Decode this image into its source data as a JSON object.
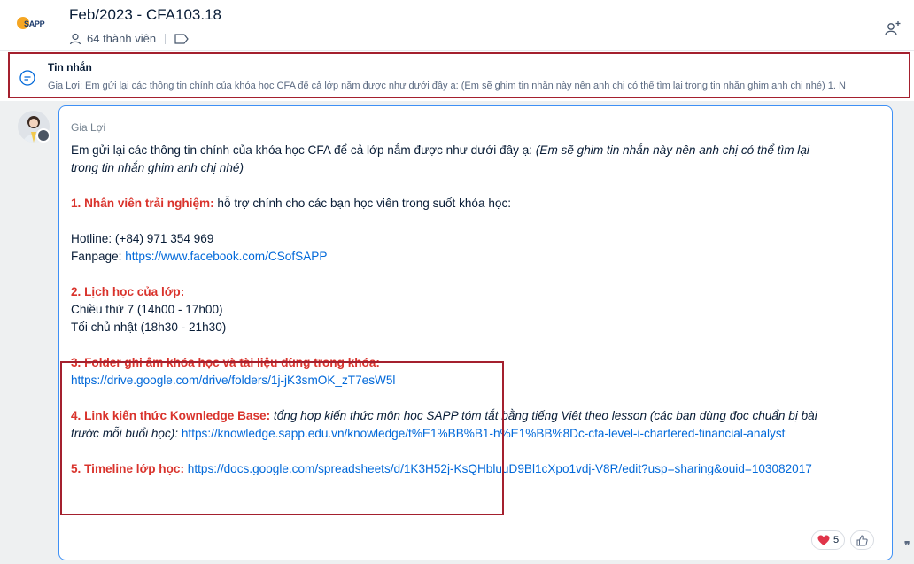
{
  "header": {
    "logo_text": "SAPP",
    "title": "Feb/2023 - CFA103.18",
    "members": "64 thành viên"
  },
  "pinned": {
    "title": "Tin nhắn",
    "preview": "Gia Lợi: Em gửi lại các thông tin chính của khóa học CFA để cả lớp nắm được như dưới đây ạ: (Em sẽ ghim tin nhắn này nên anh chị có thể tìm lại trong tin nhắn ghim anh chị nhé) 1. N"
  },
  "message": {
    "sender": "Gia Lợi",
    "intro": "Em gửi lại các thông tin chính của khóa học CFA để cả lớp nắm được như dưới đây ạ: ",
    "intro_note_1": "(Em sẽ ghim tin nhắn này nên anh chị có thể tìm lại",
    "intro_note_2": "trong tin nhắn ghim anh chị nhé)",
    "s1_head": "1. Nhân viên trải nghiệm:",
    "s1_text": " hỗ trợ chính cho các bạn học viên trong suốt khóa học:",
    "hotline": "Hotline: (+84) 971 354 969",
    "fanpage_label": "Fanpage: ",
    "fanpage_link": "https://www.facebook.com/CSofSAPP",
    "s2_head": "2. Lịch học của lớp:",
    "s2_line1": "Chiều thứ 7 (14h00 - 17h00)",
    "s2_line2": "Tối chủ nhật (18h30 - 21h30)",
    "s3_head": "3. Folder ghi âm khóa học và tài liệu dùng trong khóa:",
    "s3_link": "https://drive.google.com/drive/folders/1j-jK3smOK_zT7esW5l",
    "s4_head": "4. Link kiến thức Kownledge Base:",
    "s4_note_1": " tổng hợp kiến thức môn học SAPP tóm tắt bằng tiếng Việt theo lesson (các bạn dùng đọc chuẩn bị bài",
    "s4_note_2": "trước mỗi buổi học):",
    "s4_link": " https://knowledge.sapp.edu.vn/knowledge/t%E1%BB%B1-h%E1%BB%8Dc-cfa-level-i-chartered-financial-analyst",
    "s5_head": "5. Timeline lớp học:",
    "s5_link": " https://docs.google.com/spreadsheets/d/1K3H52j-KsQHbluuD9Bl1cXpo1vdj-V8R/edit?usp=sharing&ouid=103082017"
  },
  "reactions": {
    "heart_count": "5"
  },
  "colors": {
    "accent_red": "#d9332c",
    "link_blue": "#0068d9",
    "highlight_border": "#a4202e"
  }
}
